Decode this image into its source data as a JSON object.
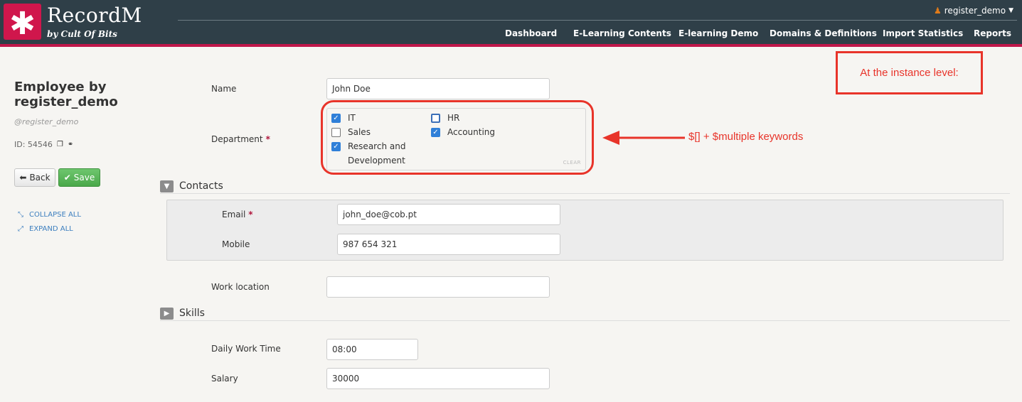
{
  "app": {
    "brand": "RecordM",
    "tagline": "by Cult Of Bits",
    "logo_glyph": "✱",
    "user": "register_demo",
    "nav": [
      "Dashboard",
      "E-Learning Contents",
      "E-learning Demo",
      "Domains & Definitions",
      "Import Statistics",
      "Reports"
    ]
  },
  "sidebar": {
    "title": "Employee by register_demo",
    "subtitle": "@register_demo",
    "id_label": "ID: 54546",
    "back_label": "Back",
    "save_label": "Save",
    "collapse_all": "COLLAPSE ALL",
    "expand_all": "EXPAND ALL"
  },
  "form": {
    "name": {
      "label": "Name",
      "value": "John Doe"
    },
    "department": {
      "label": "Department",
      "clear_label": "CLEAR",
      "options": [
        {
          "label": "IT",
          "checked": true
        },
        {
          "label": "HR",
          "checked": false
        },
        {
          "label": "Sales",
          "checked": false
        },
        {
          "label": "Accounting",
          "checked": true
        },
        {
          "label": "Research and Development",
          "checked": true
        }
      ]
    },
    "contacts": {
      "title": "Contacts",
      "email": {
        "label": "Email",
        "value": "john_doe@cob.pt"
      },
      "mobile": {
        "label": "Mobile",
        "value": "987 654 321"
      }
    },
    "work_location": {
      "label": "Work location",
      "value": ""
    },
    "skills": {
      "title": "Skills"
    },
    "daily_work_time": {
      "label": "Daily Work Time",
      "value": "08:00"
    },
    "salary": {
      "label": "Salary",
      "value": "30000"
    }
  },
  "annotations": {
    "keywords": "$[] + $multiple keywords",
    "instance_level": "At the instance level:",
    "color": "#e8342a"
  },
  "colors": {
    "header_bg": "#2f3f48",
    "brand_accent": "#d0164c",
    "save_green": "#5cb85c",
    "checkbox_blue": "#2f7fd8"
  }
}
